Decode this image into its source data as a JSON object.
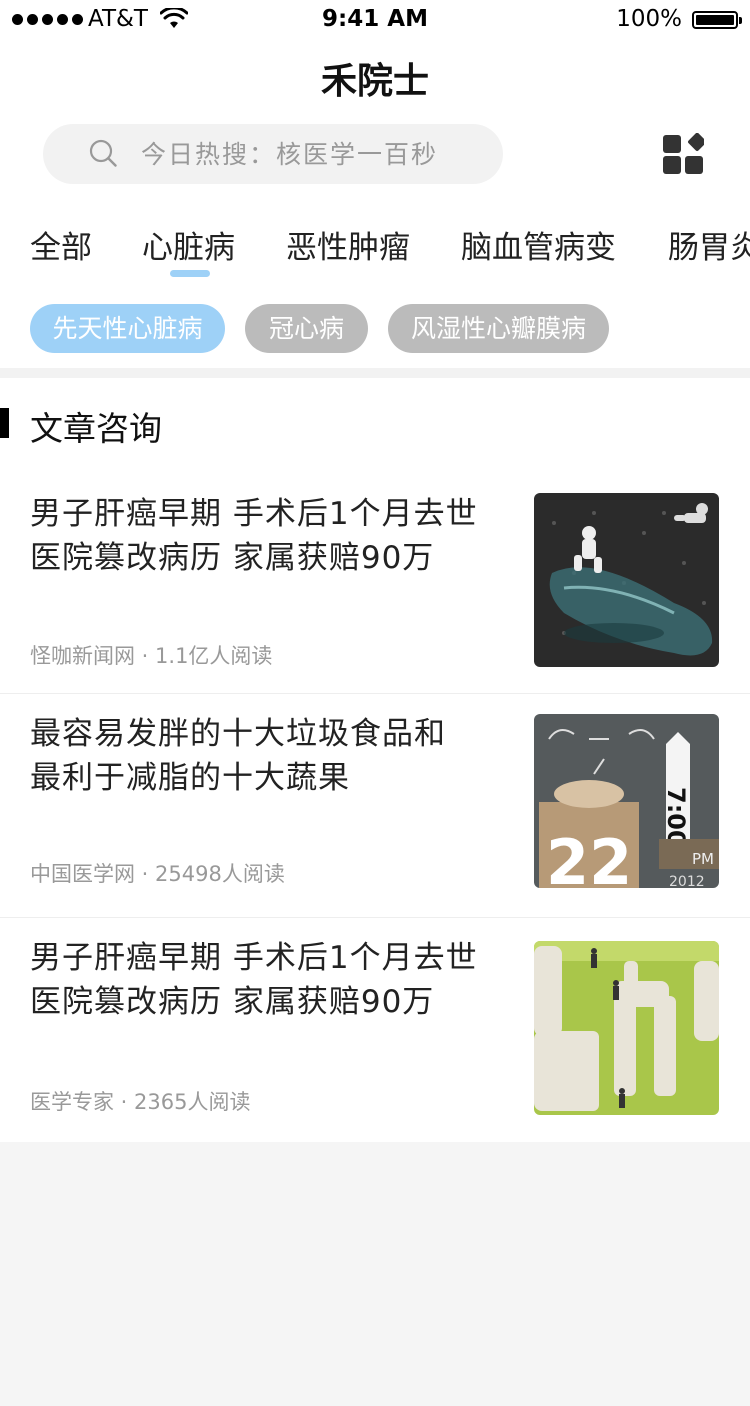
{
  "status_bar": {
    "carrier": "AT&T",
    "time": "9:41 AM",
    "battery": "100%"
  },
  "app": {
    "title": "禾院士"
  },
  "search": {
    "placeholder": "今日热搜：核医学一百秒"
  },
  "categories": {
    "tabs": [
      "全部",
      "心脏病",
      "恶性肿瘤",
      "脑血管病变",
      "肠胃炎"
    ],
    "active_index": 1,
    "chips": [
      {
        "label": "先天性心脏病",
        "active": true
      },
      {
        "label": "冠心病",
        "active": false
      },
      {
        "label": "风湿性心瓣膜病",
        "active": false
      }
    ]
  },
  "section": {
    "title": "文章咨询"
  },
  "articles": [
    {
      "title_line1": "男子肝癌早期 手术后1个月去世",
      "title_line2": "医院篡改病历 家属获赔90万",
      "source": "怪咖新闻网",
      "reads": "1.1亿人阅读",
      "thumb_icon": "astronaut-bottle-image"
    },
    {
      "title_line1": "最容易发胖的十大垃圾食品和",
      "title_line2": "最利于减脂的十大蔬果",
      "source": "中国医学网",
      "reads": "25498人阅读",
      "thumb_icon": "calendar-clock-image",
      "thumb_text_big": "22",
      "thumb_text_clock": "7:00",
      "thumb_text_pm": "PM",
      "thumb_text_year": "2012"
    },
    {
      "title_line1": "男子肝癌早期 手术后1个月去世",
      "title_line2": "医院篡改病历 家属获赔90万",
      "source": "医学专家",
      "reads": "2365人阅读",
      "thumb_icon": "miniature-stonehenge-image"
    }
  ],
  "colors": {
    "accent": "#9ed1f7",
    "chip_inactive": "#bbbbbb",
    "background": "#f5f5f5"
  }
}
